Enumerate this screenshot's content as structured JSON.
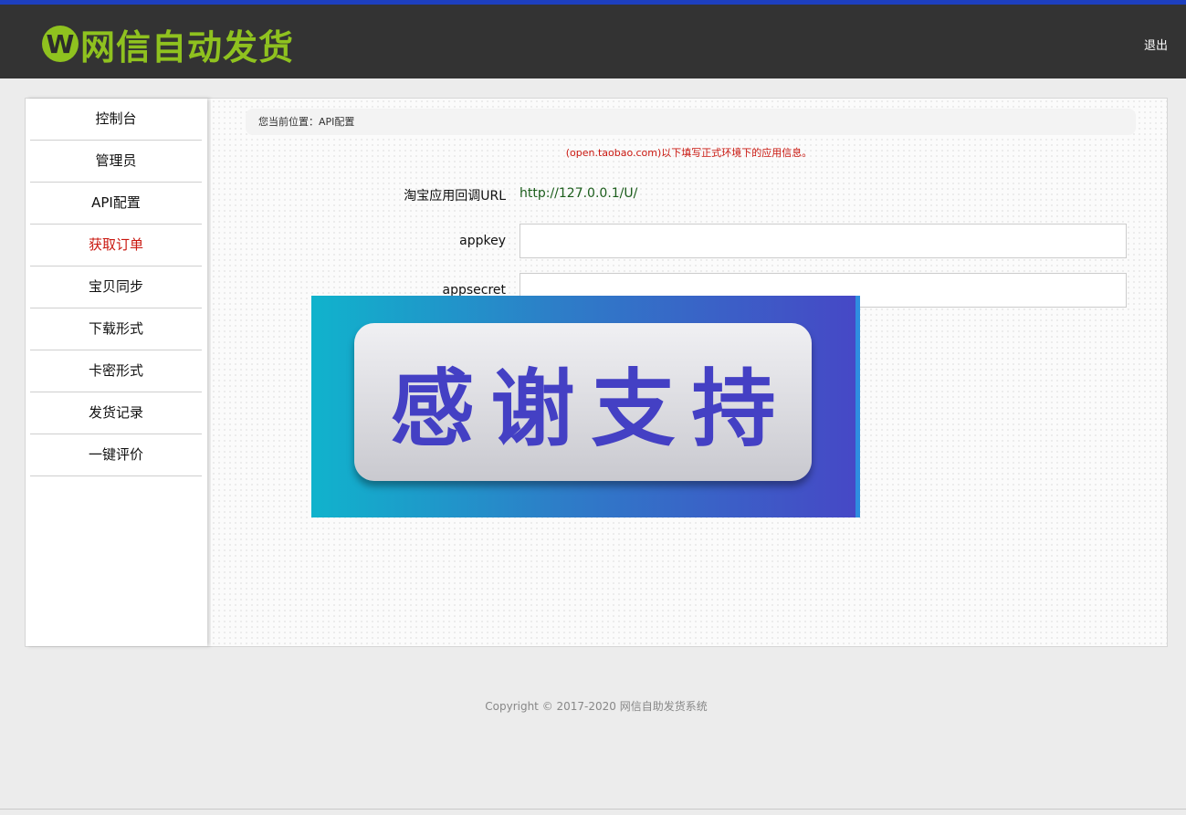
{
  "header": {
    "logo_mark": "W",
    "logo_text": "网信自动发货",
    "logout_label": "退出"
  },
  "sidebar": {
    "items": [
      {
        "label": "控制台"
      },
      {
        "label": "管理员"
      },
      {
        "label": "API配置"
      },
      {
        "label": "获取订单"
      },
      {
        "label": "宝贝同步"
      },
      {
        "label": "下载形式"
      },
      {
        "label": "卡密形式"
      },
      {
        "label": "发货记录"
      },
      {
        "label": "一键评价"
      }
    ]
  },
  "content": {
    "breadcrumb": "您当前位置：API配置",
    "notice": "(open.taobao.com)以下填写正式环境下的应用信息。",
    "callback_label": "淘宝应用回调URL",
    "callback_value": "http://127.0.0.1/U/",
    "appkey_label": "appkey",
    "appkey_value": "",
    "appsecret_label": "appsecret",
    "appsecret_value": ""
  },
  "banner": {
    "text": "感谢支持"
  },
  "footer": {
    "copyright": "Copyright © 2017-2020 网信自助发货系统"
  },
  "colors": {
    "accent_green": "#8fc21f",
    "header_bg": "#333333",
    "active_red": "#c9170f",
    "top_accent_blue": "#1d3fbf"
  }
}
